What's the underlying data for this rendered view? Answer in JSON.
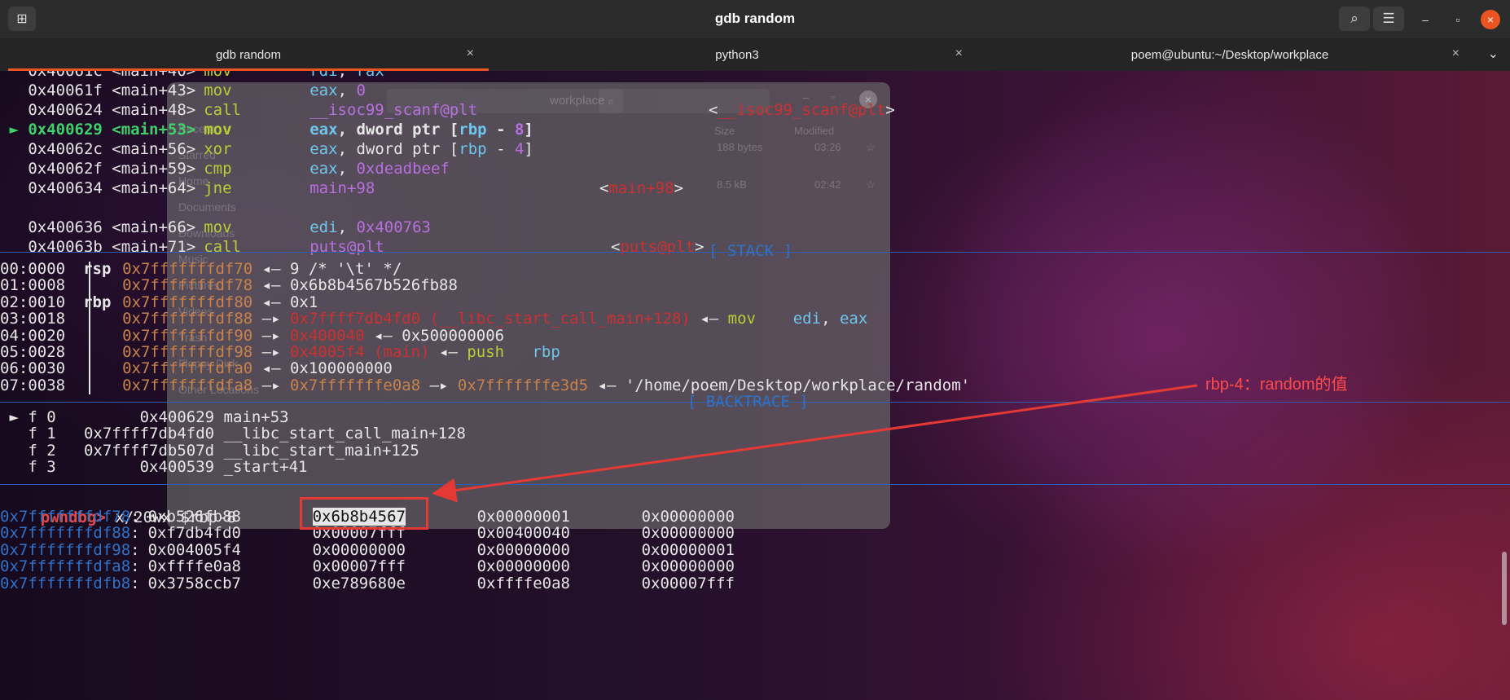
{
  "window": {
    "title": "gdb random",
    "new_tab_icon": "⊞",
    "search_icon": "⌕",
    "menu_icon": "☰",
    "minimize_icon": "–",
    "maximize_icon": "▫",
    "close_icon": "×"
  },
  "tabs": [
    {
      "label": "gdb random",
      "active": true
    },
    {
      "label": "python3",
      "active": false
    },
    {
      "label": "poem@ubuntu:~/Desktop/workplace",
      "active": false
    }
  ],
  "tab_close_icon": "×",
  "tab_menu_icon": "⌄",
  "ghost_window": {
    "path_text": "workplace",
    "sidebar": [
      "Recent",
      "Starred",
      "Home",
      "Documents",
      "Downloads",
      "Music",
      "Pictures",
      "Videos",
      "Trash",
      "Floppy Disk",
      "Other Locations"
    ],
    "col_size": "Size",
    "col_modified": "Modified",
    "rows": [
      {
        "size": "188 bytes",
        "time": "03:26"
      },
      {
        "size": "8.5 kB",
        "time": "02:42"
      }
    ]
  },
  "disasm": [
    {
      "addr": "0x40061c <main+40>",
      "mn": "mov",
      "ops": [
        [
          "reg",
          "rdi"
        ],
        [
          "punc",
          ", "
        ],
        [
          "reg",
          "rax"
        ]
      ],
      "tgt": ""
    },
    {
      "addr": "0x40061f <main+43>",
      "mn": "mov",
      "ops": [
        [
          "reg",
          "eax"
        ],
        [
          "punc",
          ", "
        ],
        [
          "num",
          "0"
        ]
      ],
      "tgt": ""
    },
    {
      "addr": "0x400624 <main+48>",
      "mn": "call",
      "ops": [
        [
          "sym",
          "__isoc99_scanf@plt"
        ]
      ],
      "tgt": "<__isoc99_scanf@plt>"
    },
    {
      "addr": "0x400629 <main+53>",
      "mn": "mov",
      "ops": [
        [
          "reg",
          "eax"
        ],
        [
          "punc",
          ", "
        ],
        [
          "white",
          "dword ptr "
        ],
        [
          "punc",
          "["
        ],
        [
          "reg",
          "rbp"
        ],
        [
          "punc",
          " - "
        ],
        [
          "num",
          "8"
        ],
        [
          "punc",
          "]"
        ]
      ],
      "tgt": "",
      "current": true
    },
    {
      "addr": "0x40062c <main+56>",
      "mn": "xor",
      "ops": [
        [
          "reg",
          "eax"
        ],
        [
          "punc",
          ", "
        ],
        [
          "white",
          "dword ptr "
        ],
        [
          "punc",
          "["
        ],
        [
          "reg",
          "rbp"
        ],
        [
          "punc",
          " - "
        ],
        [
          "num",
          "4"
        ],
        [
          "punc",
          "]"
        ]
      ],
      "tgt": ""
    },
    {
      "addr": "0x40062f <main+59>",
      "mn": "cmp",
      "ops": [
        [
          "reg",
          "eax"
        ],
        [
          "punc",
          ", "
        ],
        [
          "num",
          "0xdeadbeef"
        ]
      ],
      "tgt": ""
    },
    {
      "addr": "0x400634 <main+64>",
      "mn": "jne",
      "ops": [
        [
          "sym",
          "main+98"
        ]
      ],
      "tgt": "<main+98>"
    },
    {
      "addr": "",
      "mn": "",
      "ops": [],
      "tgt": ""
    },
    {
      "addr": "0x400636 <main+66>",
      "mn": "mov",
      "ops": [
        [
          "reg",
          "edi"
        ],
        [
          "punc",
          ", "
        ],
        [
          "num",
          "0x400763"
        ]
      ],
      "tgt": ""
    },
    {
      "addr": "0x40063b <main+71>",
      "mn": "call",
      "ops": [
        [
          "sym",
          "puts@plt"
        ]
      ],
      "tgt": "<puts@plt>"
    }
  ],
  "current_marker": "►",
  "stack_label": "[ STACK ]",
  "stack": [
    {
      "off": "00:0000",
      "reg": "rsp",
      "addr": "0x7fffffffdf70",
      "rest": [
        [
          "white",
          " ◂— 9 /* '\\t' */"
        ]
      ]
    },
    {
      "off": "01:0008",
      "reg": "",
      "addr": "0x7fffffffdf78",
      "rest": [
        [
          "white",
          " ◂— 0x6b8b4567b526fb88"
        ]
      ]
    },
    {
      "off": "02:0010",
      "reg": "rbp",
      "addr": "0x7fffffffdf80",
      "rest": [
        [
          "white",
          " ◂— 0x1"
        ]
      ]
    },
    {
      "off": "03:0018",
      "reg": "",
      "addr": "0x7fffffffdf88",
      "rest": [
        [
          "white",
          " —▸ "
        ],
        [
          "red",
          "0x7ffff7db4fd0 (__libc_start_call_main+128)"
        ],
        [
          "white",
          " ◂— "
        ],
        [
          "green",
          "mov    "
        ],
        [
          "reg",
          "edi"
        ],
        [
          "white",
          ", "
        ],
        [
          "reg",
          "eax"
        ]
      ]
    },
    {
      "off": "04:0020",
      "reg": "",
      "addr": "0x7fffffffdf90",
      "rest": [
        [
          "white",
          " —▸ "
        ],
        [
          "red",
          "0x400040"
        ],
        [
          "white",
          " ◂— 0x500000006"
        ]
      ]
    },
    {
      "off": "05:0028",
      "reg": "",
      "addr": "0x7fffffffdf98",
      "rest": [
        [
          "white",
          " —▸ "
        ],
        [
          "red",
          "0x4005f4 (main)"
        ],
        [
          "white",
          " ◂— "
        ],
        [
          "green",
          "push   "
        ],
        [
          "reg",
          "rbp"
        ]
      ]
    },
    {
      "off": "06:0030",
      "reg": "",
      "addr": "0x7fffffffdfa0",
      "rest": [
        [
          "white",
          " ◂— 0x100000000"
        ]
      ]
    },
    {
      "off": "07:0038",
      "reg": "",
      "addr": "0x7fffffffdfa8",
      "rest": [
        [
          "white",
          " —▸ "
        ],
        [
          "stackaddr",
          "0x7fffffffe0a8"
        ],
        [
          "white",
          " —▸ "
        ],
        [
          "stackaddr",
          "0x7fffffffe3d5"
        ],
        [
          "white",
          " ◂— '/home/poem/Desktop/workplace/random'"
        ]
      ]
    }
  ],
  "backtrace_label": "[ BACKTRACE ]",
  "backtrace": [
    " ► f 0         0x400629 main+53",
    "   f 1   0x7ffff7db4fd0 __libc_start_call_main+128",
    "   f 2   0x7ffff7db507d __libc_start_main+125",
    "   f 3         0x400539 _start+41"
  ],
  "prompt": "pwndbg>",
  "command": " x/20wx $rbp-8",
  "memory": [
    {
      "addr": "0x7fffffffdf78",
      "vals": [
        "0xb526fb88",
        "0x6b8b4567",
        "0x00000001",
        "0x00000000"
      ]
    },
    {
      "addr": "0x7fffffffdf88",
      "vals": [
        "0xf7db4fd0",
        "0x00007fff",
        "0x00400040",
        "0x00000000"
      ]
    },
    {
      "addr": "0x7fffffffdf98",
      "vals": [
        "0x004005f4",
        "0x00000000",
        "0x00000000",
        "0x00000001"
      ]
    },
    {
      "addr": "0x7fffffffdfa8",
      "vals": [
        "0xffffe0a8",
        "0x00007fff",
        "0x00000000",
        "0x00000000"
      ]
    },
    {
      "addr": "0x7fffffffdfb8",
      "vals": [
        "0x3758ccb7",
        "0xe789680e",
        "0xffffe0a8",
        "0x00007fff"
      ]
    }
  ],
  "annotation": "rbp-4：random的值"
}
